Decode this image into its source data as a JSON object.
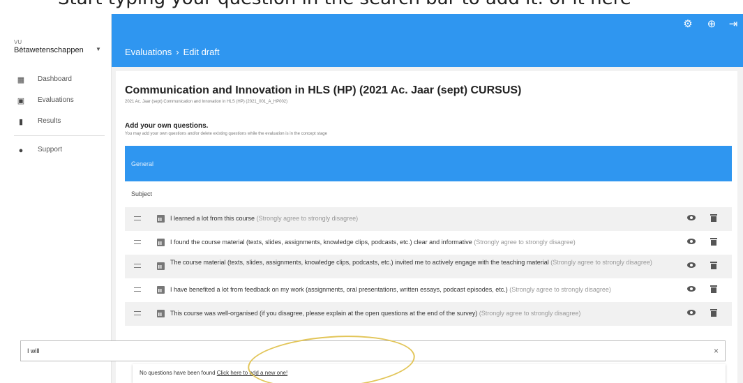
{
  "caption": "Start typing your question in the search bar to add it. of it here",
  "sidebar": {
    "org_small": "VU",
    "org_name": "Bètawetenschappen",
    "items": [
      {
        "label": "Dashboard",
        "icon": "dashboard-icon"
      },
      {
        "label": "Evaluations",
        "icon": "clipboard-icon"
      },
      {
        "label": "Results",
        "icon": "bar-chart-icon"
      },
      {
        "label": "Support",
        "icon": "help-icon"
      }
    ]
  },
  "appbar": {
    "breadcrumb": [
      "Evaluations",
      "Edit draft"
    ],
    "separator": "›",
    "icons": [
      "gear-icon",
      "globe-icon",
      "logout-icon"
    ]
  },
  "main": {
    "title": "Communication and Innovation in HLS (HP) (2021 Ac. Jaar (sept) CURSUS)",
    "subtitle": "2021 Ac. Jaar (sept) Communication and Innovation in HLS (HP) (2021_001_A_HP002)",
    "section_title": "Add your own questions.",
    "section_subtitle": "You may add your own questions and/or delete existing questions while the evaluation is in the concept stage",
    "group": {
      "header": "General",
      "subject_label": "Subject",
      "questions": [
        {
          "text": "I learned a lot from this course",
          "scale": "(Strongly agree to strongly disagree)"
        },
        {
          "text": "I found the course material (texts, slides, assignments, knowledge clips, podcasts, etc.) clear and informative",
          "scale": "(Strongly agree to strongly disagree)"
        },
        {
          "text": "The course material (texts, slides, assignments, knowledge clips, podcasts, etc.) invited me to actively engage with the teaching material",
          "scale": "(Strongly agree to strongly disagree)"
        },
        {
          "text": "I have benefited a lot from feedback on my work (assignments, oral presentations, written essays, podcast episodes, etc.)",
          "scale": "(Strongly agree to strongly disagree)"
        },
        {
          "text": "This course was well-organised (if you disagree, please explain at the open questions at the end of the survey)",
          "scale": "(Strongly agree to strongly disagree)"
        }
      ]
    },
    "search": {
      "value": "I will",
      "clear": "×"
    },
    "dropdown": {
      "message": "No questions have been found",
      "link": "Click here to add a new one!"
    }
  },
  "colors": {
    "primary": "#2f96f0",
    "background": "#f2f2f2",
    "annotation": "#e2c558"
  }
}
